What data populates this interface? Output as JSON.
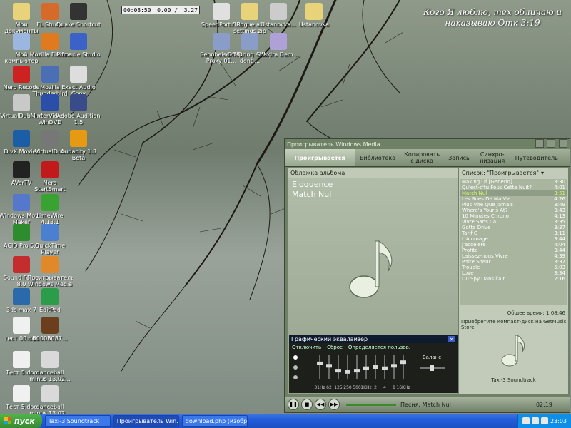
{
  "desktop": {
    "quote": "Кого Я люблю, тех обличаю и наказываю    Отк 3:19",
    "mini_player": {
      "time": "00:08:50",
      "slash": "0.00 /",
      "total": "3.27"
    },
    "icons": [
      {
        "label": "Мои документы",
        "color": "#e8d27a"
      },
      {
        "label": "FL Studio",
        "color": "#d66a2b"
      },
      {
        "label": "Quake Shortcut",
        "color": "#333333"
      },
      {
        "label": "Мой компьютер",
        "color": "#9bb7e0"
      },
      {
        "label": "Mozilla Firefox",
        "color": "#e07a1e"
      },
      {
        "label": "Pinnacle Studio",
        "color": "#3c62c8"
      },
      {
        "label": "Nero Recode",
        "color": "#cc2222"
      },
      {
        "label": "Mozilla Thunderbird",
        "color": "#4a6fb5"
      },
      {
        "label": "Exact Audio Copy",
        "color": "#dddddd"
      },
      {
        "label": "VirtualDubMod",
        "color": "#c9c9c9"
      },
      {
        "label": "InterVideo WinDVD",
        "color": "#2b4fa8"
      },
      {
        "label": "Adobe Audition 1.5",
        "color": "#3a4b8a"
      },
      {
        "label": "DivX Movies",
        "color": "#1c5ea6"
      },
      {
        "label": "VirtualDub",
        "color": "#777777"
      },
      {
        "label": "Audacity 1.3 Beta",
        "color": "#e69a12"
      },
      {
        "label": "AVerTV",
        "color": "#222222"
      },
      {
        "label": "Nero StartSmart",
        "color": "#c21a1a"
      },
      {
        "label": "Windows Movie Maker",
        "color": "#5577cc"
      },
      {
        "label": "LimeWire 4.13.1",
        "color": "#39a332"
      },
      {
        "label": "ACID Pro 5.0",
        "color": "#2d8c2d"
      },
      {
        "label": "QuickTime Player",
        "color": "#4b7fcf"
      },
      {
        "label": "Sound Forge 8.0",
        "color": "#c42d2d"
      },
      {
        "label": "Проигрыватель Windows Media",
        "color": "#e0882a"
      },
      {
        "label": "3ds max 7",
        "color": "#2a6aab"
      },
      {
        "label": "EditPad",
        "color": "#2a9c4a"
      },
      {
        "label": "тест 00.doc",
        "color": "#f0f0f0"
      },
      {
        "label": "B000B087...",
        "color": "#6b3e1e"
      },
      {
        "label": "Тест 5.doc",
        "color": "#f0f0f0"
      },
      {
        "label": "danceball minus 13.02...",
        "color": "#d9d9d9"
      },
      {
        "label": "Тест 5.doc",
        "color": "#f0f0f0"
      },
      {
        "label": "danceball minus 13.02...",
        "color": "#d9d9d9"
      },
      {
        "label": "SpeedPort.fl...",
        "color": "#e0e0e0"
      },
      {
        "label": "Rogue all settings.zip",
        "color": "#e8d27a"
      },
      {
        "label": "Ustanovka...",
        "color": "#cccccc"
      },
      {
        "label": "Ustanovka",
        "color": "#e8d27a"
      },
      {
        "label": "Sennheiser HD Proxy 01...",
        "color": "#8a9dc8"
      },
      {
        "label": "Offspring - Why dont ...",
        "color": "#8a9dc8"
      },
      {
        "label": "Shakira Dem ...",
        "color": "#b0a0d8"
      }
    ]
  },
  "wmp": {
    "title": "Проигрыватель Windows Media",
    "tabs": [
      "Проигрывается",
      "Библиотека",
      "Копировать с диска",
      "Запись",
      "Синхро-низация",
      "Путеводитель"
    ],
    "album_art_label": "Обложка альбома",
    "artist": "Eloquence",
    "song": "Match Nul",
    "playlist_label": "Список: \"Проигрывается\"",
    "tracks": [
      {
        "name": "Making Of [Generiq]",
        "time": "3:30"
      },
      {
        "name": "Qu'est-c'tu Fous Cette Nuit?",
        "time": "4:01"
      },
      {
        "name": "Match Nul",
        "time": "3:51"
      },
      {
        "name": "Les Rues De Ma Vie",
        "time": "4:26"
      },
      {
        "name": "Plus Vite Que Jamais",
        "time": "3:49"
      },
      {
        "name": "Where's Your's At?",
        "time": "3:43"
      },
      {
        "name": "10 Minutes Chrono",
        "time": "4:13"
      },
      {
        "name": "Vivre Sans Ca",
        "time": "3:35"
      },
      {
        "name": "Gotta Drive",
        "time": "3:37"
      },
      {
        "name": "Tarif C",
        "time": "3:11"
      },
      {
        "name": "L'Alumage",
        "time": "3:44"
      },
      {
        "name": "J'accelere",
        "time": "4:04"
      },
      {
        "name": "Profite",
        "time": "3:44"
      },
      {
        "name": "Laissez-nous Vivre",
        "time": "4:39"
      },
      {
        "name": "P'tite Soeur",
        "time": "3:37"
      },
      {
        "name": "Trouble",
        "time": "5:03"
      },
      {
        "name": "Love",
        "time": "3:34"
      },
      {
        "name": "Du Spy Dans l'air",
        "time": "2:16"
      }
    ],
    "total_time": "Общее время: 1:08:46",
    "store_text": "Приобретите компакт-диск на GetMusic Store",
    "album": "Taxi-3 Soundtrack",
    "eq": {
      "title": "Графический эквалайзер",
      "disable": "Отключить",
      "reset": "Сброс",
      "preset": "Определяется пользов.",
      "balance": "Баланс",
      "bands": [
        "31Hz",
        "62",
        "125",
        "250",
        "500",
        "1KHz",
        "2",
        "4",
        "8",
        "16KHz"
      ],
      "levels": [
        0.65,
        0.55,
        0.35,
        0.3,
        0.35,
        0.45,
        0.5,
        0.45,
        0.55,
        0.7
      ]
    },
    "now_playing": "Песня: Match Nul",
    "elapsed": "02:19"
  },
  "taskbar": {
    "start": "пуск",
    "tasks": [
      "Taxi-3 Soundtrack",
      "Проигрыватель Win...",
      "download.php (изобр..."
    ],
    "clock": "23:03"
  }
}
